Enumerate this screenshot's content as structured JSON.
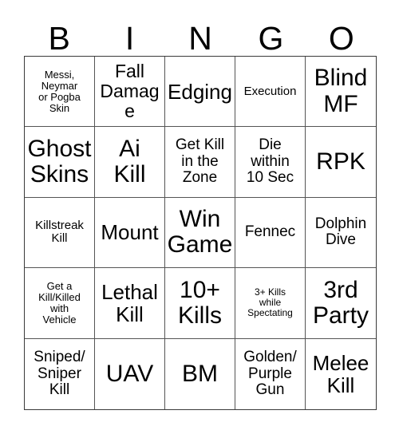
{
  "card": {
    "title": "BINGO",
    "header_letters": [
      "B",
      "I",
      "N",
      "G",
      "O"
    ],
    "grid_size": "5x5",
    "background_color": "#ffffff",
    "text_color": "#000000",
    "border_color": "#555555",
    "rows": [
      [
        {
          "text": "Messi,\nNeymar\nor Pogba\nSkin",
          "size": "fs-xs",
          "marked": false
        },
        {
          "text": "Fall\nDamage",
          "size": "fs-lg",
          "marked": false
        },
        {
          "text": "Edging",
          "size": "fs-xl",
          "marked": false
        },
        {
          "text": "Execution",
          "size": "fs-sm",
          "marked": false
        },
        {
          "text": "Blind\nMF",
          "size": "fs-xxl",
          "marked": false
        }
      ],
      [
        {
          "text": "Ghost\nSkins",
          "size": "fs-xxl",
          "marked": false
        },
        {
          "text": "Ai\nKill",
          "size": "fs-xxl",
          "marked": false
        },
        {
          "text": "Get Kill\nin the\nZone",
          "size": "fs-md",
          "marked": false
        },
        {
          "text": "Die\nwithin\n10 Sec",
          "size": "fs-md",
          "marked": false
        },
        {
          "text": "RPK",
          "size": "fs-xxl",
          "marked": false
        }
      ],
      [
        {
          "text": "Killstreak\nKill",
          "size": "fs-sm",
          "marked": false
        },
        {
          "text": "Mount",
          "size": "fs-xl",
          "marked": false
        },
        {
          "text": "Win\nGame",
          "size": "fs-xxl",
          "marked": false
        },
        {
          "text": "Fennec",
          "size": "fs-md",
          "marked": false
        },
        {
          "text": "Dolphin\nDive",
          "size": "fs-md",
          "marked": false
        }
      ],
      [
        {
          "text": "Get a\nKill/Killed\nwith\nVehicle",
          "size": "fs-xs",
          "marked": false
        },
        {
          "text": "Lethal\nKill",
          "size": "fs-xl",
          "marked": false
        },
        {
          "text": "10+\nKills",
          "size": "fs-xxl",
          "marked": false
        },
        {
          "text": "3+ Kills\nwhile\nSpectating",
          "size": "fs-xxs",
          "marked": false
        },
        {
          "text": "3rd\nParty",
          "size": "fs-xxl",
          "marked": false
        }
      ],
      [
        {
          "text": "Sniped/\nSniper\nKill",
          "size": "fs-md",
          "marked": false
        },
        {
          "text": "UAV",
          "size": "fs-xxl",
          "marked": false
        },
        {
          "text": "BM",
          "size": "fs-xxl",
          "marked": false
        },
        {
          "text": "Golden/\nPurple\nGun",
          "size": "fs-md",
          "marked": false
        },
        {
          "text": "Melee\nKill",
          "size": "fs-xl",
          "marked": false
        }
      ]
    ]
  }
}
